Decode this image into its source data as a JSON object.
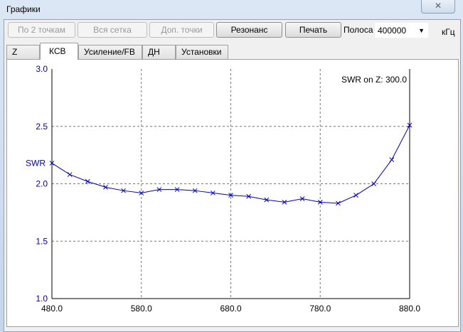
{
  "window": {
    "title": "Графики",
    "close_icon": "close-icon"
  },
  "toolbar": {
    "by_2_points": "По 2 точкам",
    "all_grid": "Вся сетка",
    "extra_points": "Доп. точки",
    "resonance": "Резонанс",
    "print": "Печать",
    "band_label": "Полоса",
    "band_value": "400000",
    "band_unit": "кГц"
  },
  "tabs": [
    "Z",
    "КСВ",
    "Усиление/FB",
    "ДН",
    "Установки"
  ],
  "active_tab": "КСВ",
  "chart_data": {
    "type": "line",
    "title": "SWR on Z: 300.0",
    "xlabel": "",
    "ylabel": "SWR",
    "xlim": [
      480,
      880
    ],
    "ylim": [
      1.0,
      3.0
    ],
    "xticks": [
      "480.0",
      "580.0",
      "680.0",
      "780.0",
      "880.0"
    ],
    "yticks": [
      "1.0",
      "1.5",
      "2.0",
      "2.5",
      "3.0"
    ],
    "grid": true,
    "color": "#0000c0",
    "x": [
      480,
      500,
      520,
      540,
      560,
      580,
      600,
      620,
      640,
      660,
      680,
      700,
      720,
      740,
      760,
      780,
      800,
      820,
      840,
      860,
      880
    ],
    "y": [
      2.18,
      2.08,
      2.02,
      1.97,
      1.94,
      1.92,
      1.95,
      1.95,
      1.94,
      1.92,
      1.9,
      1.89,
      1.86,
      1.84,
      1.87,
      1.84,
      1.83,
      1.9,
      2.0,
      2.21,
      2.51
    ]
  }
}
